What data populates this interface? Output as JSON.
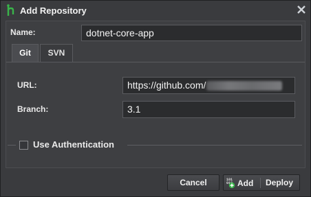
{
  "window": {
    "title": "Add Repository",
    "accent_color": "#39b54a"
  },
  "form": {
    "name_label": "Name:",
    "name_value": "dotnet-core-app"
  },
  "tabs": [
    {
      "label": "Git",
      "active": true
    },
    {
      "label": "SVN",
      "active": false
    }
  ],
  "git": {
    "url_label": "URL:",
    "url_value": "https://github.com/",
    "url_redacted": true,
    "branch_label": "Branch:",
    "branch_value": "3.1"
  },
  "auth": {
    "label": "Use Authentication",
    "checked": false
  },
  "footer": {
    "cancel_label": "Cancel",
    "add_label": "Add",
    "deploy_label": "Deploy"
  }
}
